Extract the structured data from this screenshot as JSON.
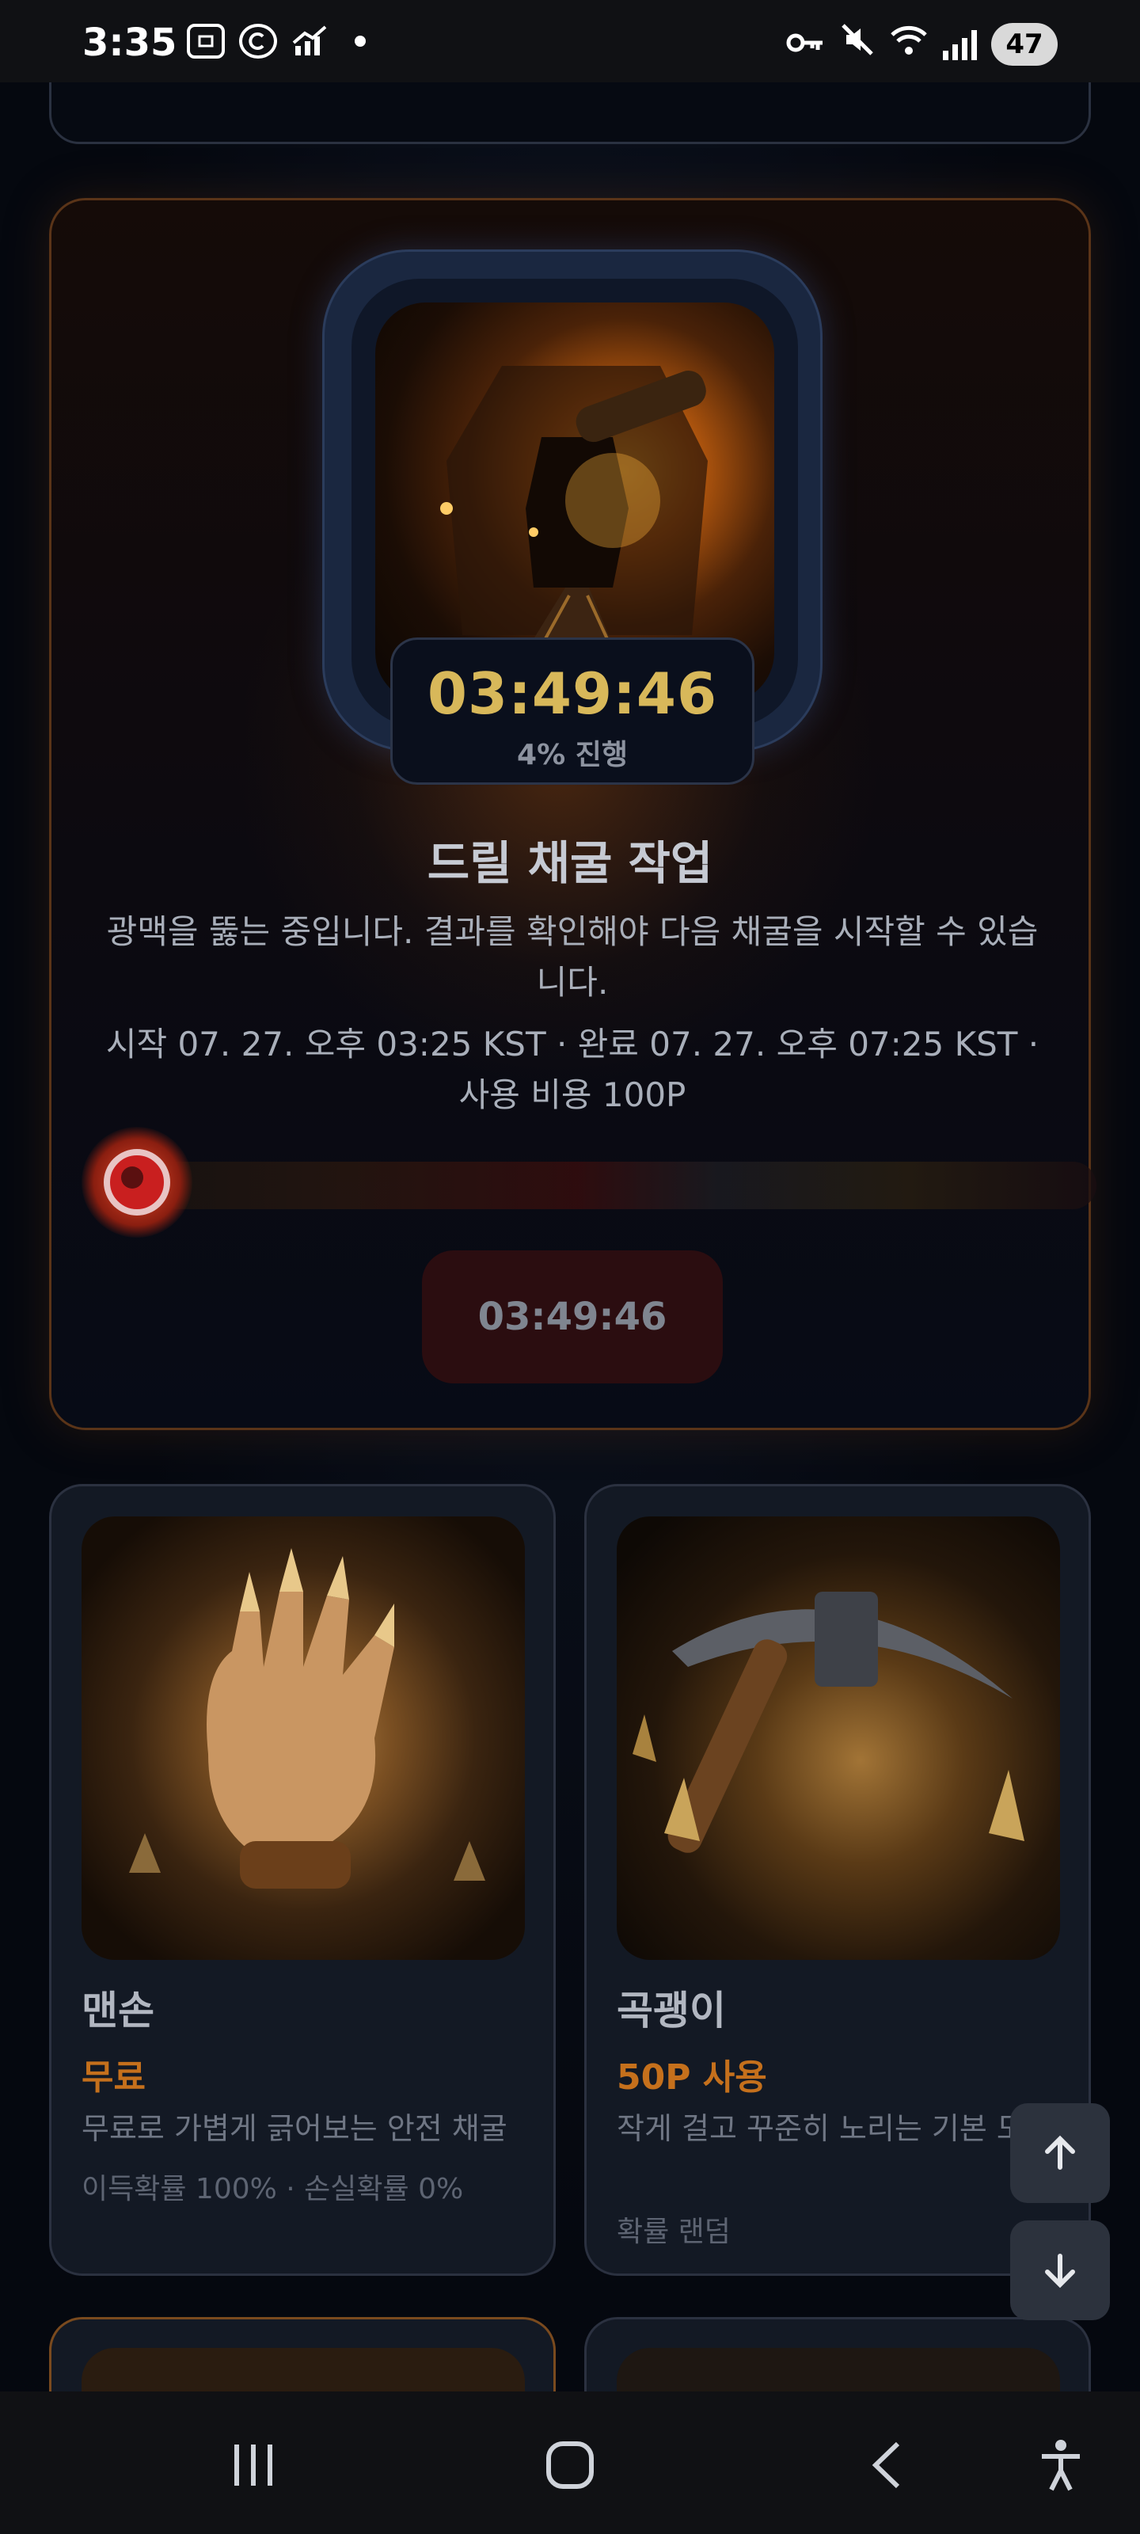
{
  "status_bar": {
    "time": "3:35",
    "battery": "47",
    "left_icons": [
      "screenshot-icon",
      "c-app-icon",
      "chart-icon"
    ],
    "right_icons": [
      "vpn-key-icon",
      "mute-icon",
      "wifi-icon",
      "signal-icon"
    ]
  },
  "mining": {
    "timer": "03:49:46",
    "progress_label": "4% 진행",
    "progress_value": 0.04,
    "title": "드릴 채굴 작업",
    "description": "광맥을 뚫는 중입니다. 결과를 확인해야 다음 채굴을 시작할 수 있습니다.",
    "info": "시작 07. 27. 오후 03:25 KST · 완료 07. 27. 오후 07:25 KST · 사용 비용 100P",
    "button_label": "03:49:46"
  },
  "items": [
    {
      "name": "맨손",
      "price": "무료",
      "description": "무료로 가볍게 긁어보는 안전 채굴",
      "rate": "이득확률 100% · 손실확률 0%"
    },
    {
      "name": "곡괭이",
      "price": "50P 사용",
      "description": "작게 걸고 꾸준히 노리는 기본 도구",
      "rate": "확률 랜덤"
    }
  ],
  "colors": {
    "accent_gold": "#d8b85a",
    "price_orange": "#c5701c",
    "card_border": "#2b3140",
    "mining_border": "#5a3418"
  }
}
